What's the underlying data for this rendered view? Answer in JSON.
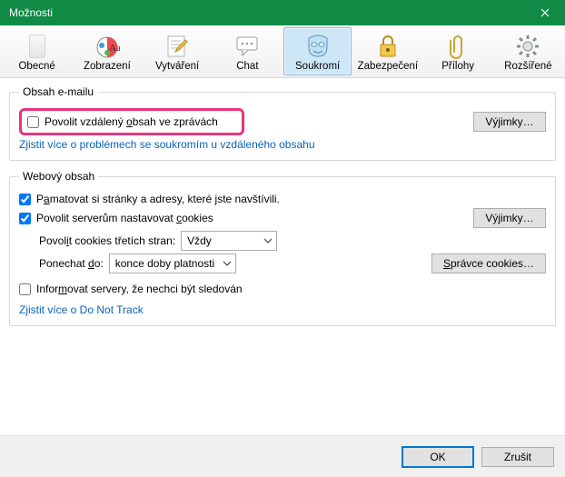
{
  "window": {
    "title": "Možnosti"
  },
  "tabs": [
    {
      "label": "Obecné"
    },
    {
      "label": "Zobrazení"
    },
    {
      "label": "Vytváření"
    },
    {
      "label": "Chat"
    },
    {
      "label": "Soukromí"
    },
    {
      "label": "Zabezpečení"
    },
    {
      "label": "Přílohy"
    },
    {
      "label": "Rozšířené"
    }
  ],
  "email": {
    "legend": "Obsah e-mailu",
    "allow_remote_label_pre": "Povolit vzdálený ",
    "allow_remote_label_u": "o",
    "allow_remote_label_post": "bsah ve zprávách",
    "exceptions_label_pre": "Vý",
    "exceptions_label_u": "j",
    "exceptions_label_post": "imky…",
    "learn_more": "Zjistit více o problémech se soukromím u vzdáleného obsahu"
  },
  "web": {
    "legend": "Webový obsah",
    "remember_pre": "P",
    "remember_u": "a",
    "remember_post": "matovat si stránky a adresy, které jste navštívili.",
    "cookies_pre": "Povolit serverům nastavovat ",
    "cookies_u": "c",
    "cookies_post": "ookies",
    "exceptions_label_pre": "Vý",
    "exceptions_label_u": "j",
    "exceptions_label_post": "imky…",
    "third_party_label_pre": "Povol",
    "third_party_label_u": "i",
    "third_party_label_post": "t cookies třetích stran:",
    "third_party_value": "Vždy",
    "keep_label_pre": "Ponechat ",
    "keep_label_u": "d",
    "keep_label_post": "o:",
    "keep_value": "konce doby platnosti",
    "manage_cookies_label_pre": "",
    "manage_cookies_label_u": "S",
    "manage_cookies_label_post": "právce cookies…",
    "dnt_pre": "Infor",
    "dnt_u": "m",
    "dnt_post": "ovat servery, že nechci být sledován",
    "dnt_link": "Zjistit více o Do Not Track"
  },
  "footer": {
    "ok": "OK",
    "cancel": "Zrušit"
  }
}
